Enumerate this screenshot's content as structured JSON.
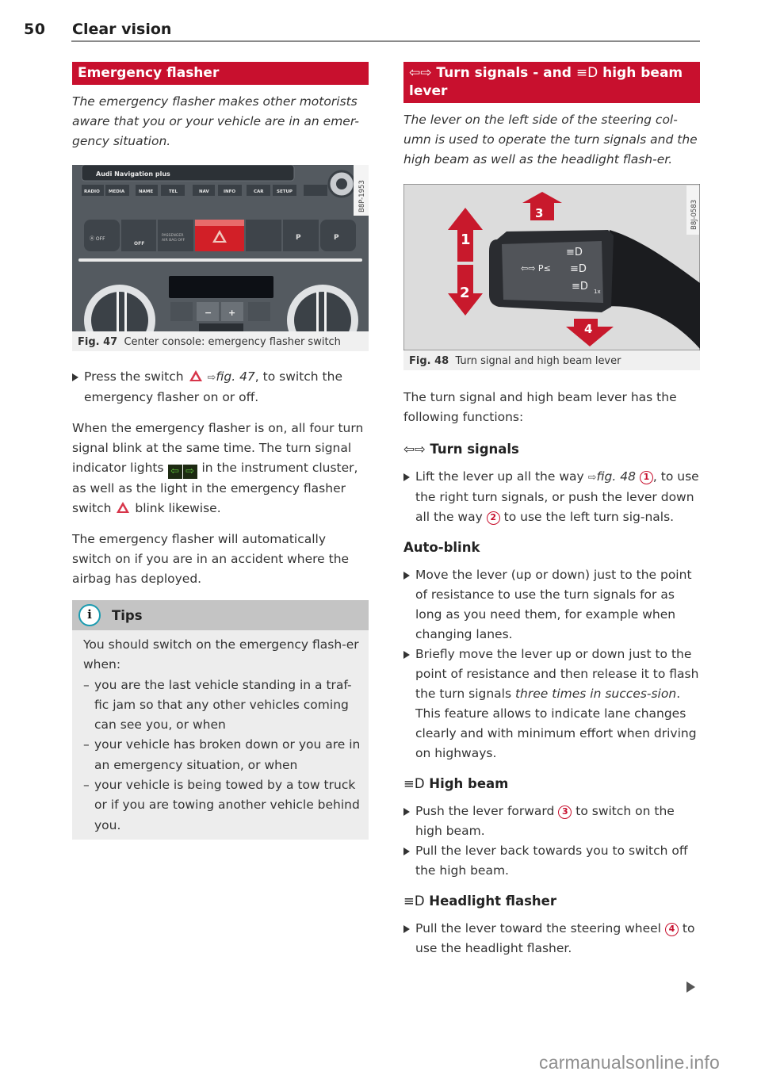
{
  "header": {
    "page_number": "50",
    "chapter_title": "Clear vision"
  },
  "left": {
    "heading": "Emergency flasher",
    "intro": "The emergency flasher makes other motorists aware that you or your vehicle are in an emer-gency situation.",
    "figure": {
      "code": "B8P-1953",
      "number": "Fig. 47",
      "caption": "Center console: emergency flasher switch",
      "nav_title": "Audi Navigation plus",
      "nav_buttons": [
        "RADIO",
        "MEDIA",
        "NAME",
        "TEL",
        "NAV",
        "INFO",
        "CAR",
        "SETUP"
      ],
      "switch_labels": [
        "Ⓐ OFF",
        "OFF",
        "PASSENGER AIR BAG OFF",
        "",
        "",
        "P",
        "P"
      ],
      "climate_buttons": [
        "−",
        "+"
      ]
    },
    "step": {
      "text_before": "Press the switch",
      "ref_arrow": "⇨",
      "fig_ref": "fig. 47",
      "text_after": ", to switch the emergency flasher on or off."
    },
    "para1": {
      "part1": "When the emergency flasher is on, all four turn signal blink at the same time. The turn signal indicator lights",
      "left_indicator": "⇦",
      "right_indicator": "⇨",
      "part2": "in the instrument cluster, as well as the light in the emergency flasher switch",
      "part3": "blink likewise."
    },
    "para2": "The emergency flasher will automatically switch on if you are in an accident where the airbag has deployed.",
    "tips": {
      "icon": "i",
      "title": "Tips",
      "intro": "You should switch on the emergency flash-er when:",
      "items": [
        "you are the last vehicle standing in a traf-fic jam so that any other vehicles coming can see you, or when",
        "your vehicle has broken down or you are in an emergency situation, or when",
        "your vehicle is being towed by a tow truck or if you are towing another vehicle behind you."
      ]
    }
  },
  "right": {
    "heading": {
      "arrows": "⇦⇨",
      "part1": "Turn signals - and",
      "highbeam_symbol": "≡D",
      "part2": "high beam lever"
    },
    "intro": "The lever on the left side of the steering col-umn is used to operate the turn signals and the high beam as well as the headlight flash-er.",
    "figure": {
      "code": "B8J-0583",
      "number": "Fig. 48",
      "caption": "Turn signal and high beam lever",
      "callouts": [
        "1",
        "2",
        "3",
        "4"
      ],
      "lever_labels": [
        "⇦⇨ P≤",
        "≡D",
        "≡D",
        "≡D",
        "1x"
      ]
    },
    "functions_intro": "The turn signal and high beam lever has the following functions:",
    "turn_signals": {
      "symbol": "⇦⇨",
      "title": "Turn signals",
      "bullet": {
        "part1": "Lift the lever up all the way",
        "ref_arrow": "⇨",
        "fig_ref": "fig. 48",
        "num1": "1",
        "part2": ", to use the right turn signals, or push the lever down all the way",
        "num2": "2",
        "part3": "to use the left turn sig-nals."
      }
    },
    "auto_blink": {
      "title": "Auto-blink",
      "bullets": [
        {
          "text": "Move the lever (up or down) just to the point of resistance to use the turn signals for as long as you need them, for example when changing lanes."
        },
        {
          "part1": "Briefly move the lever up or down just to the point of resistance and then release it to flash the turn signals",
          "italic": "three times in succes-sion",
          "part2": ". This feature allows to indicate lane changes clearly and with minimum effort when driving on highways."
        }
      ]
    },
    "high_beam": {
      "symbol": "≡D",
      "title": "High beam",
      "bullets": [
        {
          "part1": "Push the lever forward",
          "num": "3",
          "part2": "to switch on the high beam."
        },
        {
          "text": "Pull the lever back towards you to switch off the high beam."
        }
      ]
    },
    "headlight_flasher": {
      "symbol": "≡D",
      "title": "Headlight flasher",
      "bullet": {
        "part1": "Pull the lever toward the steering wheel",
        "num": "4",
        "part2": "to use the headlight flasher."
      }
    }
  },
  "watermark": "carmanualsonline.info",
  "colors": {
    "accent_red": "#c8102e",
    "tips_header": "#c4c4c4",
    "tips_body": "#ededed",
    "info_icon_ring": "#1a9bb0",
    "indicator_green": "#5ec43a"
  }
}
